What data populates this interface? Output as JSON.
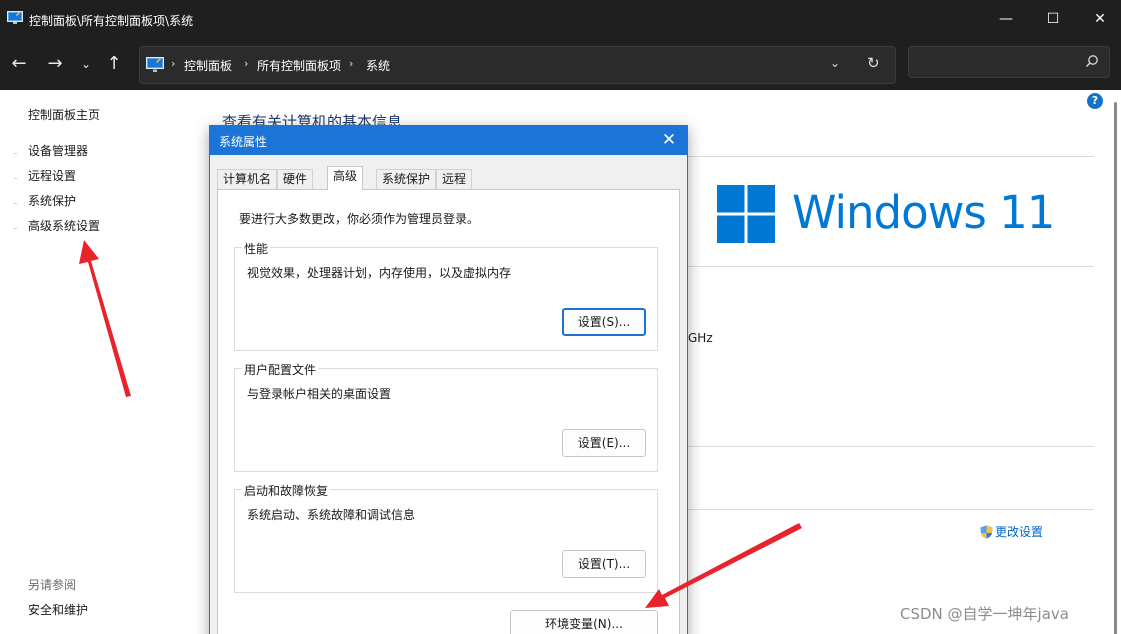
{
  "window": {
    "title": "控制面板\\所有控制面板项\\系统",
    "minimize_glyph": "—",
    "maximize_glyph": "☐",
    "close_glyph": "✕",
    "app_icon": "control-panel-icon"
  },
  "nav": {
    "back": "←",
    "forward": "→",
    "recent": "⌄",
    "up": "↑",
    "breadcrumb_sep": "›",
    "breadcrumbs": [
      "控制面板",
      "所有控制面板项",
      "系统"
    ],
    "dropdown_glyph": "⌄",
    "refresh_glyph": "↻",
    "search_placeholder": "",
    "search_icon": "search-icon"
  },
  "sidebar": {
    "home": "控制面板主页",
    "items": [
      "设备管理器",
      "远程设置",
      "系统保护",
      "高级系统设置"
    ],
    "see_also_label": "另请参阅",
    "see_also_items": [
      "安全和维护"
    ]
  },
  "main": {
    "heading": "查看有关计算机的基本信息",
    "windows_edition": "Windows 11",
    "cpu_fragment": "GHz",
    "change_settings": "更改设置",
    "help_glyph": "?"
  },
  "dialog": {
    "title": "系统属性",
    "close_glyph": "✕",
    "tabs": [
      "计算机名",
      "硬件",
      "高级",
      "系统保护",
      "远程"
    ],
    "active_tab": "高级",
    "admin_note": "要进行大多数更改，你必须作为管理员登录。",
    "groups": [
      {
        "title": "性能",
        "desc": "视觉效果，处理器计划，内存使用，以及虚拟内存",
        "button": "设置(S)..."
      },
      {
        "title": "用户配置文件",
        "desc": "与登录帐户相关的桌面设置",
        "button": "设置(E)..."
      },
      {
        "title": "启动和故障恢复",
        "desc": "系统启动、系统故障和调试信息",
        "button": "设置(T)..."
      }
    ],
    "env_button": "环境变量(N)..."
  },
  "watermark": "CSDN @自学一坤年java",
  "colors": {
    "accent": "#1b74d6",
    "windows_blue": "#0078d4",
    "annotation_red": "#e8232b",
    "titlebar": "#1f1f1f"
  }
}
